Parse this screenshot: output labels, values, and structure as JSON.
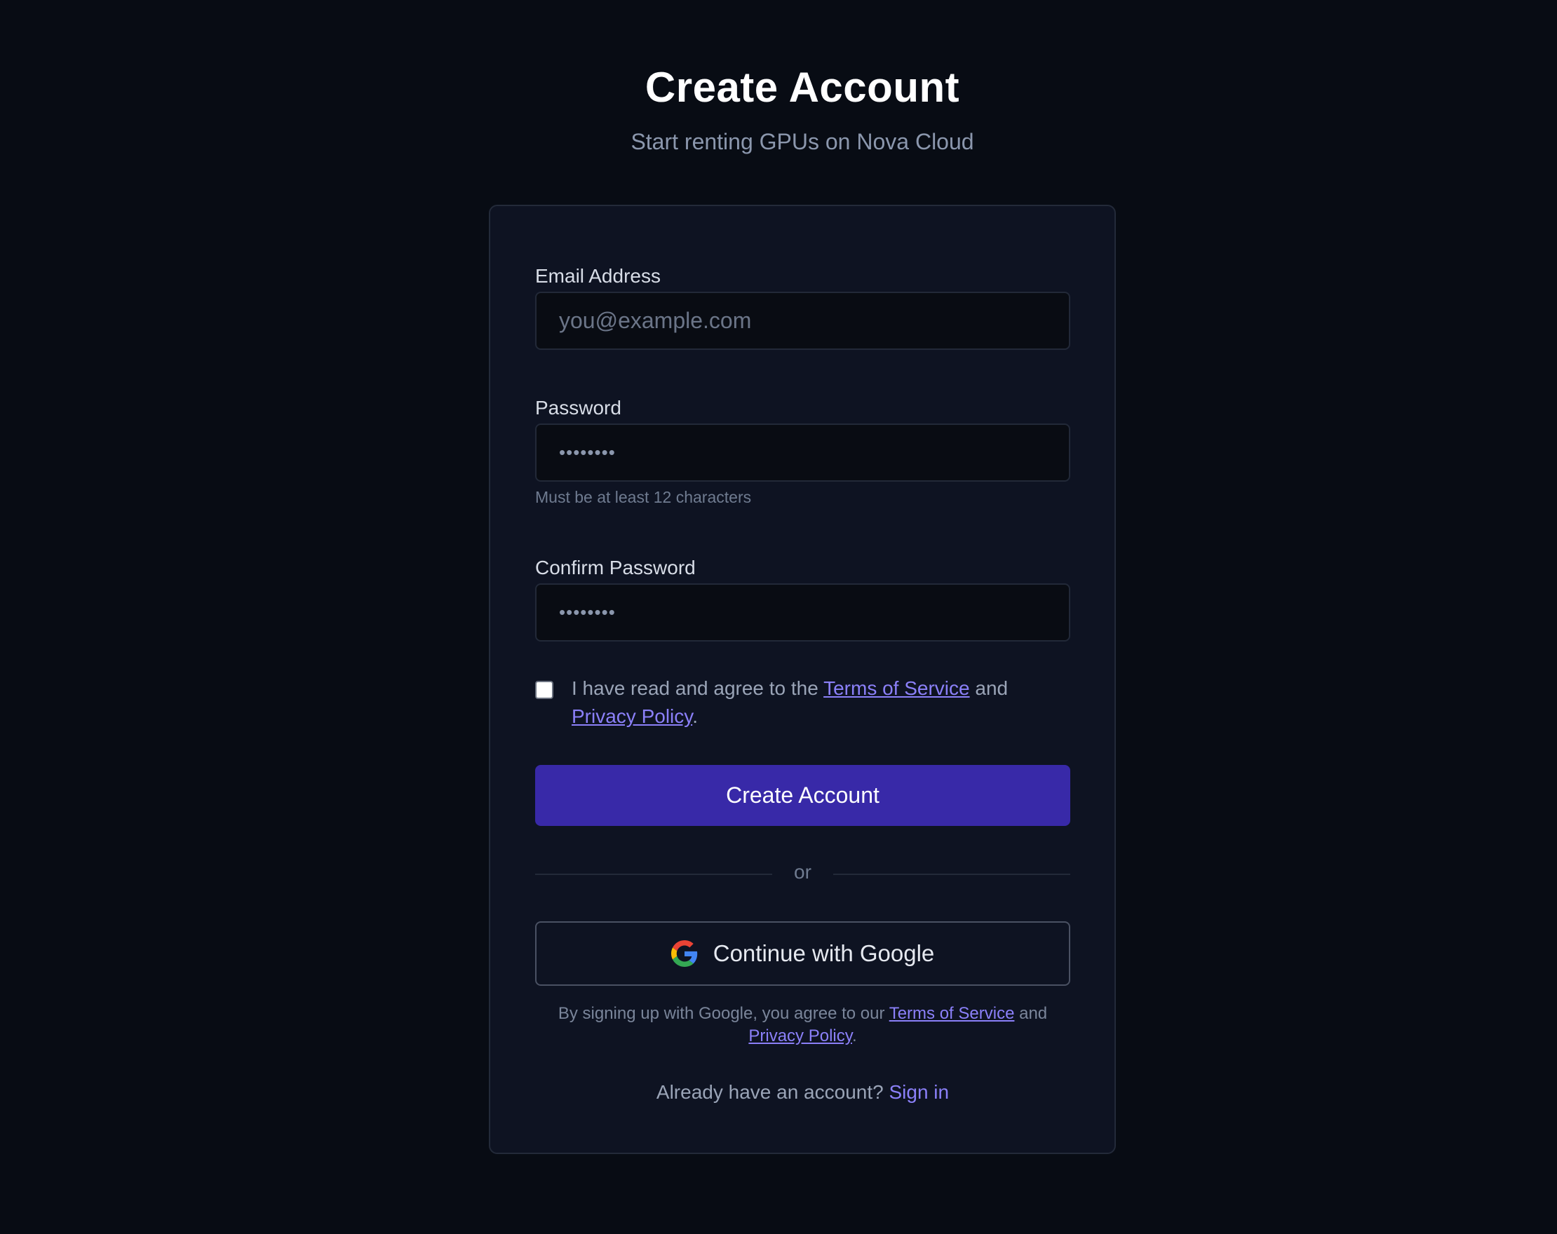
{
  "header": {
    "title": "Create Account",
    "subtitle": "Start renting GPUs on Nova Cloud"
  },
  "form": {
    "email": {
      "label": "Email Address",
      "placeholder": "you@example.com",
      "value": ""
    },
    "password": {
      "label": "Password",
      "masked_value": "••••••••",
      "hint": "Must be at least 12 characters"
    },
    "confirm_password": {
      "label": "Confirm Password",
      "masked_value": "••••••••"
    },
    "agreement": {
      "checked": false,
      "text_before": "I have read and agree to the ",
      "terms_link": "Terms of Service",
      "text_between": " and ",
      "privacy_link": "Privacy Policy",
      "text_after": "."
    },
    "submit_label": "Create Account"
  },
  "divider": {
    "label": "or"
  },
  "google": {
    "button_label": "Continue with Google",
    "icon": "google-icon",
    "fine_print_before": "By signing up with Google, you agree to our ",
    "terms_link": "Terms of Service",
    "fine_print_between": " and ",
    "privacy_link": "Privacy Policy",
    "fine_print_after": "."
  },
  "footer": {
    "question": "Already have an account? ",
    "signin_link": "Sign in"
  },
  "colors": {
    "background": "#080c14",
    "card": "#0e1322",
    "primary_button": "#3829a8",
    "link": "#8b80f9"
  }
}
